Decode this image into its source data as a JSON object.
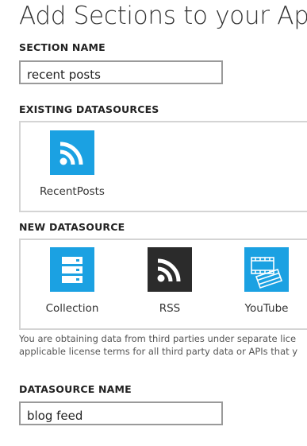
{
  "page": {
    "title": "Add Sections to your App"
  },
  "section_name": {
    "label": "SECTION NAME",
    "value": "recent posts"
  },
  "existing_datasources": {
    "label": "EXISTING DATASOURCES",
    "items": [
      {
        "label": "RecentPosts",
        "icon": "rss-icon",
        "color": "#1ba1e2"
      }
    ]
  },
  "new_datasource": {
    "label": "NEW DATASOURCE",
    "items": [
      {
        "label": "Collection",
        "icon": "collection-icon",
        "color": "#1ba1e2"
      },
      {
        "label": "RSS",
        "icon": "rss-icon",
        "color": "#2b2b2b"
      },
      {
        "label": "YouTube",
        "icon": "video-icon",
        "color": "#1ba1e2"
      }
    ]
  },
  "disclaimer": {
    "line1": "You are obtaining data from third parties under separate lice",
    "line2": "applicable license terms for all third party data or APIs that y"
  },
  "datasource_name": {
    "label": "DATASOURCE NAME",
    "value": "blog feed"
  },
  "colors": {
    "accent": "#1ba1e2",
    "dark_tile": "#2b2b2b",
    "input_border": "#9a9a9a",
    "panel_border": "#d4d4d4"
  }
}
